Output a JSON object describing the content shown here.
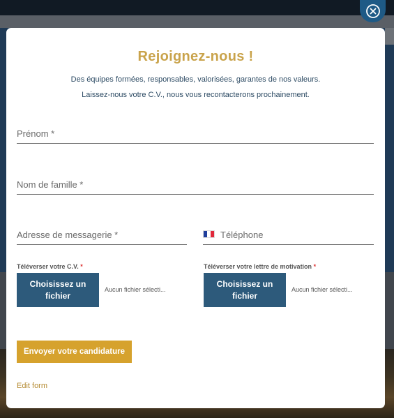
{
  "modal": {
    "title": "Rejoignez-nous !",
    "subtitle_line1": "Des équipes formées, responsables, valorisées, garantes de nos valeurs.",
    "subtitle_line2": "Laissez-nous votre C.V., nous vous recontacterons prochainement."
  },
  "form": {
    "first_name_label": "Prénom *",
    "last_name_label": "Nom de famille *",
    "email_label": "Adresse de messagerie *",
    "phone_label": "Téléphone",
    "cv_label": "Téléverser votre C.V.",
    "letter_label": "Téléverser votre lettre de motivation",
    "required_mark": "*",
    "choose_file_label": "Choisissez un fichier",
    "no_file_text": "Aucun fichier sélecti...",
    "submit_label": "Envoyer votre candidature",
    "edit_form_label": "Edit form"
  },
  "icons": {
    "close": "close-circle-icon",
    "flag": "france-flag-icon"
  },
  "colors": {
    "title": "#c9a34b",
    "upload_button": "#2d5a7b",
    "submit_button": "#d6a22d",
    "close_button": "#1e5a86"
  }
}
